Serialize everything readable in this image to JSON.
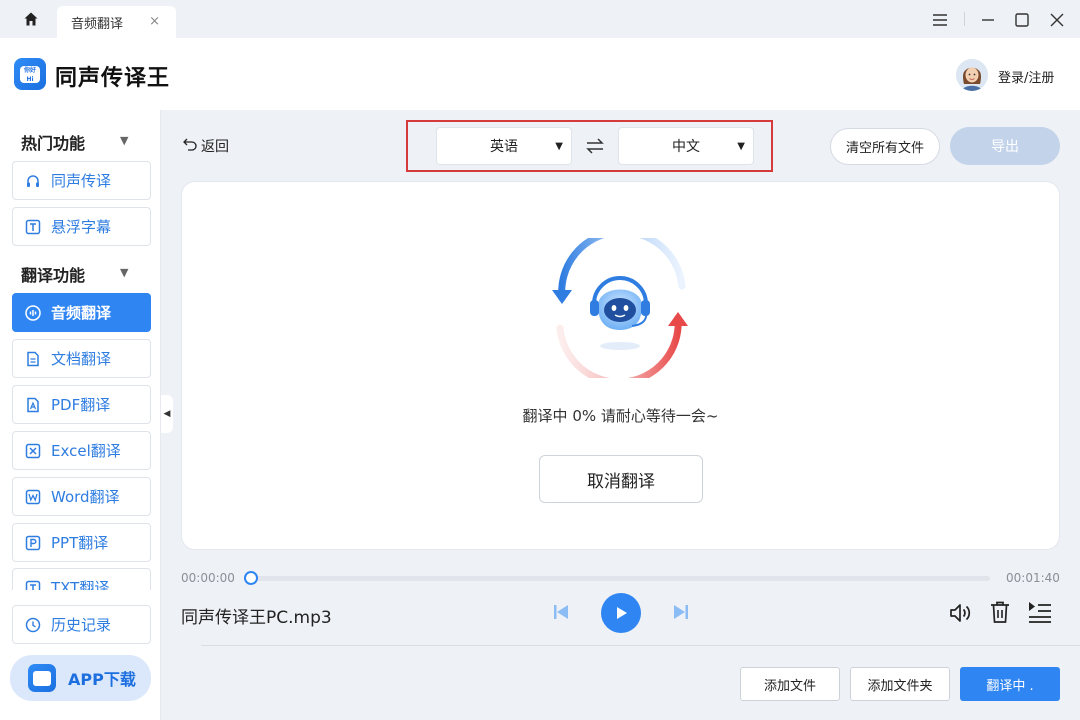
{
  "window": {
    "tab_title": "音频翻译",
    "tab_close": "×"
  },
  "header": {
    "app_title": "同声传译王",
    "logo_text": "你好 Hi",
    "login_label": "登录/注册"
  },
  "sidebar": {
    "section_hot": "热门功能",
    "section_translate": "翻译功能",
    "hot_items": [
      {
        "label": "同声传译",
        "icon": "headphones-icon"
      },
      {
        "label": "悬浮字幕",
        "icon": "text-t-icon"
      }
    ],
    "translate_items": [
      {
        "label": "音频翻译",
        "icon": "audio-wave-icon",
        "active": true
      },
      {
        "label": "文档翻译",
        "icon": "document-icon"
      },
      {
        "label": "PDF翻译",
        "icon": "pdf-icon"
      },
      {
        "label": "Excel翻译",
        "icon": "excel-icon"
      },
      {
        "label": "Word翻译",
        "icon": "word-icon"
      },
      {
        "label": "PPT翻译",
        "icon": "ppt-icon"
      },
      {
        "label": "TXT翻译",
        "icon": "txt-icon"
      }
    ],
    "history_label": "历史记录",
    "app_download_label": "APP下载"
  },
  "toolbar": {
    "back_label": "返回",
    "source_lang": "英语",
    "target_lang": "中文",
    "clear_label": "清空所有文件",
    "export_label": "导出"
  },
  "status": {
    "message": "翻译中 0% 请耐心等待一会~",
    "cancel_label": "取消翻译"
  },
  "player": {
    "time_current": "00:00:00",
    "time_total": "00:01:40",
    "progress_fraction": 0.0,
    "file_name": "同声传译王PC.mp3"
  },
  "footer": {
    "add_file_label": "添加文件",
    "add_folder_label": "添加文件夹",
    "translate_label": "翻译中 ."
  },
  "colors": {
    "accent": "#2f85f2",
    "highlight_box": "#d63b3b",
    "export_disabled": "#c3d3ea"
  }
}
